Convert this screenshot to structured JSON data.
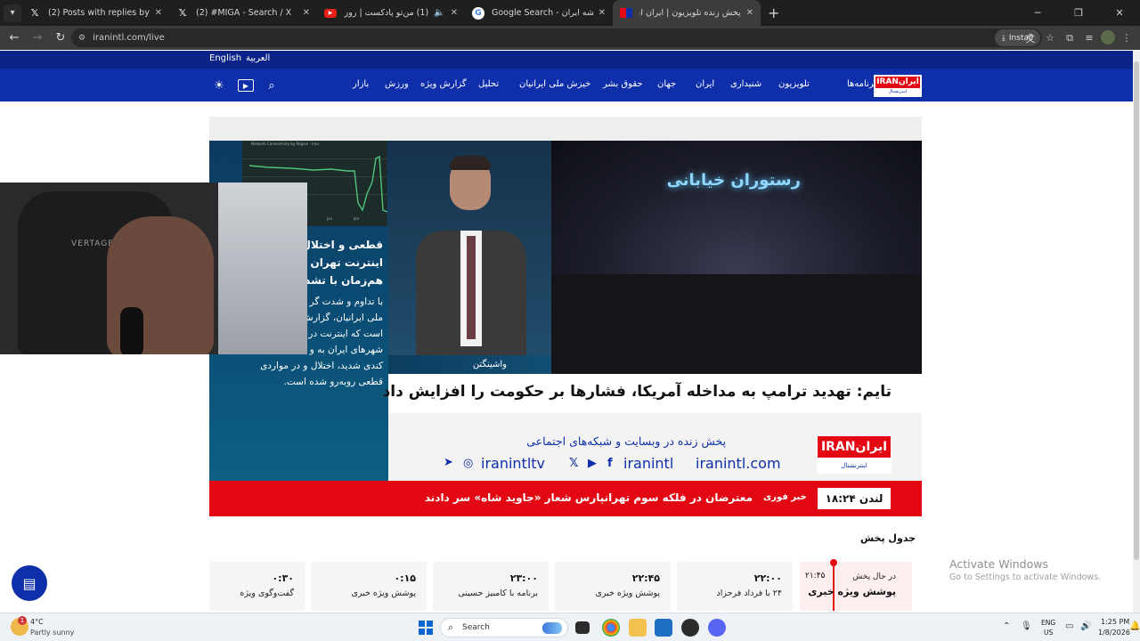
{
  "browser": {
    "tabs": [
      {
        "title": "(2) Posts with replies by Reza P",
        "icon": "x-icon"
      },
      {
        "title": "(2) #MIGA - Search / X",
        "icon": "x-icon"
      },
      {
        "title": "(1) من‌تو پادکست | روز دوازد",
        "icon": "youtube-icon"
      },
      {
        "title": "Google Search - نقشه ایران",
        "icon": "google-icon"
      },
      {
        "title": "پخش زنده تلویزیون | ایران اینترنشنال",
        "icon": "iranintl-icon"
      }
    ],
    "new_tab": "+",
    "url": "iranintl.com/live",
    "install_label": "Install"
  },
  "site": {
    "languages": [
      "English",
      "العربية"
    ],
    "nav": [
      "برنامه‌ها",
      "تلویزیون",
      "شنیداری",
      "ایران",
      "جهان",
      "حقوق بشر",
      "خیزش ملی ایرانیان",
      "تحلیل",
      "گزارش ویژه",
      "ورزش",
      "بازار"
    ],
    "logo_top": "ایرانIRAN",
    "logo_bottom": "اینترنشنال"
  },
  "player": {
    "chart_title": "Network Connectivity by Region - Iran",
    "chart_labels": [
      "Jan",
      "Jan",
      "Jan"
    ],
    "side_headline": [
      "قطعی و اختلال گ",
      "اینترنت تهران و ج",
      "هم‌زمان با تشدید"
    ],
    "side_body": [
      "با تداوم و شدت گر",
      "ملی ایرانیان، گزارش",
      "است که اینترنت در",
      "شهرهای ایران به و",
      "کندی شدید، اختلال و در مواردی",
      "قطعی روبه‌رو شده است."
    ],
    "location": "واشینگتن",
    "sign_text": "رستوران خیابانی",
    "webcam_chair_text": "VERTAGEAR",
    "headline": "تایم: تهدید ترامپ به مداخله آمریکا، فشارها بر حکومت را افزایش داد",
    "promo_line": "پخش زنده در وبسایت و شبکه‌های اجتماعی",
    "promo_tv": "iranintltv",
    "promo_handle": "iranintl",
    "promo_site": "iranintl.com",
    "logo_top": "ایرانIRAN",
    "logo_bottom": "اینترنشنال",
    "ticker_clock": "لندن ۱۸:۲۴",
    "ticker_tag": "خبر فوری",
    "ticker_text": "معترضان در فلکه سوم تهرانپارس شعار «جاوید شاه» سر دادند"
  },
  "schedule": {
    "title": "جدول پخش",
    "live": {
      "status": "در حال پخش",
      "time": "۲۱:۴۵",
      "program": "پوشش ویژه خبری"
    },
    "items": [
      {
        "time": "۲۲:۰۰",
        "program": "۲۴ با فرداد فرحزاد"
      },
      {
        "time": "۲۲:۴۵",
        "program": "پوشش ویژه خبری"
      },
      {
        "time": "۲۳:۰۰",
        "program": "برنامه با کامبیز حسینی"
      },
      {
        "time": "۰:۱۵",
        "program": "پوشش ویژه خبری"
      },
      {
        "time": "۰:۳۰",
        "program": "گفت‌وگوی ویژه"
      }
    ]
  },
  "windows_watermark": {
    "title": "Activate Windows",
    "subtitle": "Go to Settings to activate Windows."
  },
  "taskbar": {
    "weather_temp": "4°C",
    "weather_cond": "Partly sunny",
    "weather_badge": "1",
    "search_label": "Search",
    "lang": "ENG",
    "region": "US",
    "time": "1:25 PM",
    "date": "1/8/2026"
  }
}
